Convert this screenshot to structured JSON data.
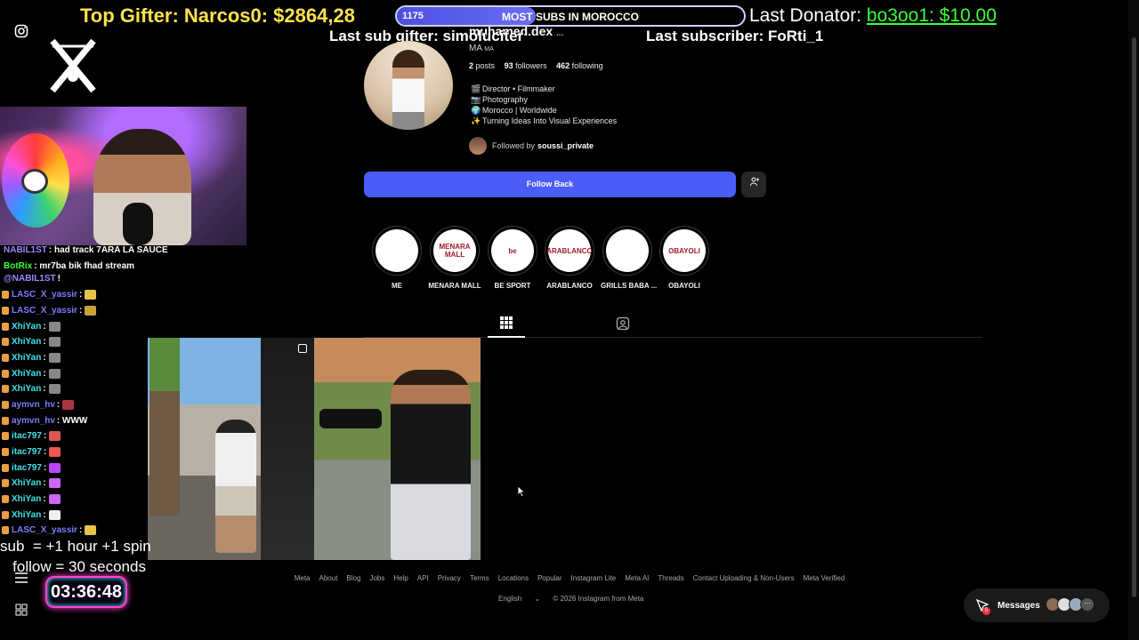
{
  "overlay": {
    "top_gifter": "Top Gifter: Narcos0: $2864,28",
    "goal_count": "1175",
    "goal_label": "MOST SUBS IN MOROCCO",
    "goal_progress": 0.4,
    "last_sub_gifter": "Last sub gifter: simoluciter",
    "last_subscriber": "Last subscriber: FoRti_1",
    "last_donator_label": "Last Donator:",
    "last_donator_value": "bo3oo1: $10.00",
    "sub_rules": "sub  = +1 hour +1 spin\n   follow = 30 seconds",
    "timer": "03:36:48"
  },
  "chat": [
    {
      "user": "NABIL1ST",
      "msg": ": had track 7ARA LA SAUCE",
      "color": "#9b8cff"
    },
    {
      "user": "BotRix",
      "msg": ": mr7ba bik fhad stream",
      "color": "#39ff3a"
    },
    {
      "user": "@NABIL1ST",
      "msg": "!",
      "color": "#9b8cff"
    },
    {
      "user": "LASC_X_yassir",
      "msg": ":",
      "color": "#7d7dff"
    },
    {
      "user": "LASC_X_yassir",
      "msg": ":",
      "color": "#7d7dff"
    },
    {
      "user": "XhiYan",
      "msg": ":",
      "color": "#3fe3e8"
    },
    {
      "user": "XhiYan",
      "msg": ":",
      "color": "#3fe3e8"
    },
    {
      "user": "XhiYan",
      "msg": ":",
      "color": "#3fe3e8"
    },
    {
      "user": "XhiYan",
      "msg": ":",
      "color": "#3fe3e8"
    },
    {
      "user": "XhiYan",
      "msg": ":",
      "color": "#3fe3e8"
    },
    {
      "user": "aymvn_hv",
      "msg": ":",
      "color": "#7d7dff"
    },
    {
      "user": "aymvn_hv",
      "msg": ": WWW",
      "color": "#7d7dff"
    },
    {
      "user": "itac797",
      "msg": ":",
      "color": "#3fe3e8"
    },
    {
      "user": "itac797",
      "msg": ":",
      "color": "#3fe3e8"
    },
    {
      "user": "itac797",
      "msg": ":",
      "color": "#3fe3e8"
    },
    {
      "user": "XhiYan",
      "msg": ":",
      "color": "#3fe3e8"
    },
    {
      "user": "XhiYan",
      "msg": ":",
      "color": "#3fe3e8"
    },
    {
      "user": "XhiYan",
      "msg": ":",
      "color": "#3fe3e8"
    },
    {
      "user": "LASC_X_yassir",
      "msg": ":",
      "color": "#7d7dff"
    }
  ],
  "profile": {
    "username": "muhamed.dex",
    "username_extra": "...",
    "small": "MA",
    "posts_count": "2",
    "posts_label": "posts",
    "followers_count": "93",
    "followers_label": "followers",
    "following_count": "462",
    "following_label": "following",
    "bio": [
      {
        "icon": "clapper-icon",
        "glyph": "🎬",
        "text": "Director • Filmmaker"
      },
      {
        "icon": "camera-icon",
        "glyph": "📷",
        "text": "Photography"
      },
      {
        "icon": "globe-icon",
        "glyph": "🌍",
        "text": "Morocco | Worldwide"
      },
      {
        "icon": "sparkles-icon",
        "glyph": "✨",
        "text": "Turning Ideas Into Visual Experiences"
      }
    ],
    "followed_by_label": "Followed by",
    "followed_by_user": "soussi_private",
    "follow_button": "Follow Back",
    "follow_color": "#4a5df9"
  },
  "highlights": [
    {
      "label": "ME",
      "logo": ""
    },
    {
      "label": "MENARA MALL",
      "logo": "MENARA MALL"
    },
    {
      "label": "BE SPORT",
      "logo": "be"
    },
    {
      "label": "ARABLANCO",
      "logo": "ARABLANCO"
    },
    {
      "label": "GRILLS BABA ...",
      "logo": ""
    },
    {
      "label": "OBAYOLI",
      "logo": "OBAYOLI"
    }
  ],
  "footer": {
    "links": [
      "Meta",
      "About",
      "Blog",
      "Jobs",
      "Help",
      "API",
      "Privacy",
      "Terms",
      "Locations",
      "Popular",
      "Instagram Lite",
      "Meta AI",
      "Threads",
      "Contact Uploading & Non-Users",
      "Meta Verified"
    ],
    "language": "English",
    "copyright": "© 2026 Instagram from Meta"
  },
  "messages": {
    "label": "Messages",
    "badge": "5"
  }
}
